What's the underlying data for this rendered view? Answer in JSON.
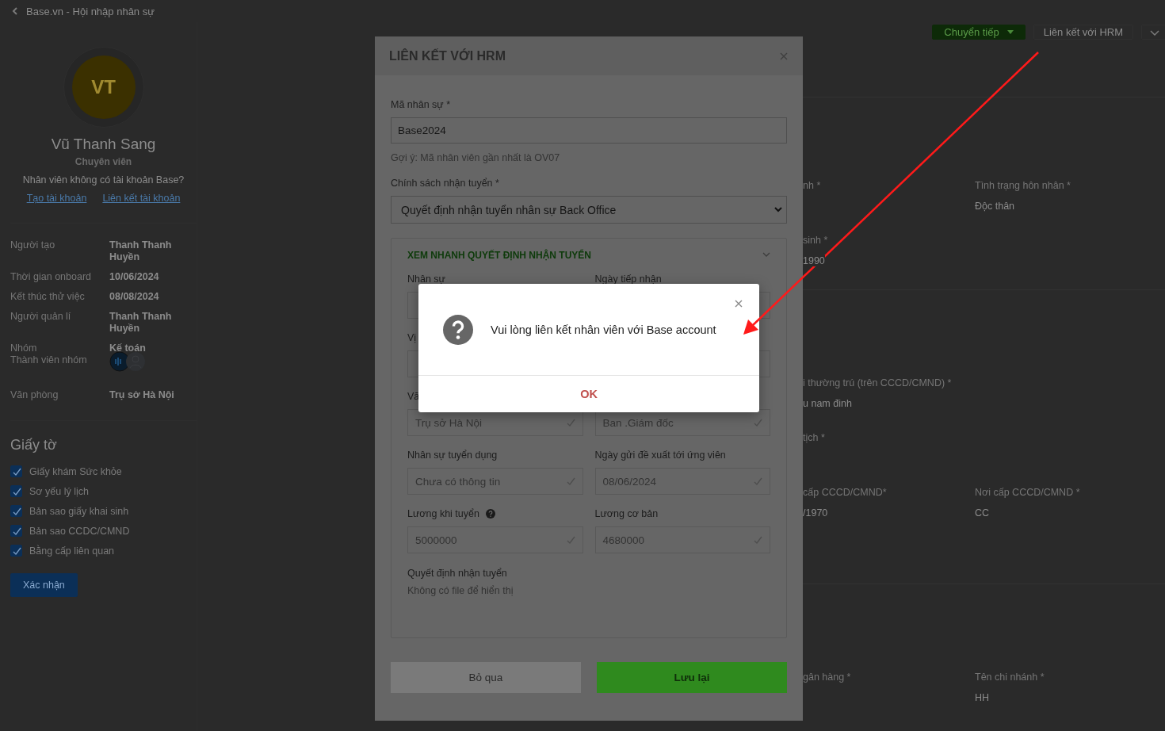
{
  "breadcrumb": "Base.vn - Hội nhập nhân sự",
  "profile": {
    "initials": "VT",
    "name": "Vũ Thanh Sang",
    "title": "Chuyên viên",
    "account_prompt": "Nhân viên không có tài khoản Base?",
    "links": [
      "Tạo tài khoản",
      "Liên kết tài khoản"
    ]
  },
  "details": [
    {
      "kind": "text",
      "label": "Người tạo",
      "value": "Thanh Thanh Huyền"
    },
    {
      "kind": "text",
      "label": "Thời gian onboard",
      "value": "10/06/2024"
    },
    {
      "kind": "text",
      "label": "Kết thúc thử việc",
      "value": "08/08/2024"
    },
    {
      "kind": "text",
      "label": "Người quản lí",
      "value": "Thanh Thanh Huyền"
    },
    {
      "kind": "group",
      "label": "Nhóm",
      "value": "Kế toán",
      "members_label": "Thành viên nhóm"
    },
    {
      "kind": "text",
      "label": "Văn phòng",
      "value": "Trụ sở Hà Nội"
    }
  ],
  "documents": {
    "title": "Giấy tờ",
    "items": [
      {
        "label": "Giấy khám Sức khỏe",
        "checked": true
      },
      {
        "label": "Sơ yếu lý lịch",
        "checked": true
      },
      {
        "label": "Bản sao giấy khai sinh",
        "checked": true
      },
      {
        "label": "Bản sao CCDC/CMND",
        "checked": true
      },
      {
        "label": "Bằng cấp liên quan",
        "checked": true
      }
    ],
    "confirm_button": "Xác nhận"
  },
  "actions": {
    "forward_button": "Chuyển tiếp",
    "link_button": "Liên kết với HRM"
  },
  "profile_sections": [
    {
      "rows": [
        [
          {
            "label": "nh *"
          },
          {
            "label": "Tình trạng hôn nhân *",
            "value": "Độc thân"
          }
        ],
        [
          {
            "label": "sinh *",
            "value": "1990"
          },
          {}
        ]
      ]
    },
    {
      "rows": [
        [
          {
            "label": "i thường trú (trên CCCD/CMND) *",
            "value": "u nam đinh"
          },
          {}
        ],
        [
          {
            "label": "tịch *"
          },
          {}
        ],
        [
          {
            "label": "cấp CCCD/CMND*",
            "value": "/1970"
          },
          {
            "label": "Nơi cấp CCCD/CMND *",
            "value": "CC"
          }
        ]
      ]
    },
    {
      "rows": [
        [
          {
            "label": "gân hàng *"
          },
          {
            "label": "Tên chi nhánh *",
            "value": "HH"
          }
        ]
      ]
    }
  ],
  "modal": {
    "title": "LIÊN KẾT VỚI HRM",
    "employee_code": {
      "label": "Mã nhân sự *",
      "value": "Base2024",
      "hint": "Gợi ý: Mã nhân viên gần nhất là OV07"
    },
    "policy": {
      "label": "Chính sách nhận tuyển *",
      "value": "Quyết định nhận tuyển nhân sự Back Office"
    },
    "preview": {
      "title": "XEM NHANH QUYẾT ĐỊNH NHẬN TUYỂN",
      "expanded": true,
      "fields": [
        {
          "label": "Nhân sự",
          "help": false
        },
        {
          "label": "Ngày tiếp nhận",
          "help": false
        },
        {
          "label": "Vị",
          "help": false
        },
        {
          "help": false
        },
        {
          "label": "Vă",
          "value": "Trụ sở Hà Nội",
          "help": false
        },
        {
          "value": "Ban .Giám đốc",
          "help": false
        },
        {
          "label": "Nhân sự tuyển dụng",
          "value": "Chưa có thông tin",
          "help": false
        },
        {
          "label": "Ngày gửi đề xuất tới ứng viên",
          "value": "08/06/2024",
          "help": false
        },
        {
          "label": "Lương khi tuyển",
          "value": "5000000",
          "help": true
        },
        {
          "label": "Lương cơ bản",
          "value": "4680000",
          "help": false
        }
      ],
      "file_label": "Quyết định nhận tuyển",
      "file_note": "Không có file để hiển thị"
    },
    "skip_button": "Bỏ qua",
    "save_button": "Lưu lại"
  },
  "alert": {
    "message": "Vui lòng liên kết nhân viên với Base account",
    "ok_button": "OK"
  }
}
